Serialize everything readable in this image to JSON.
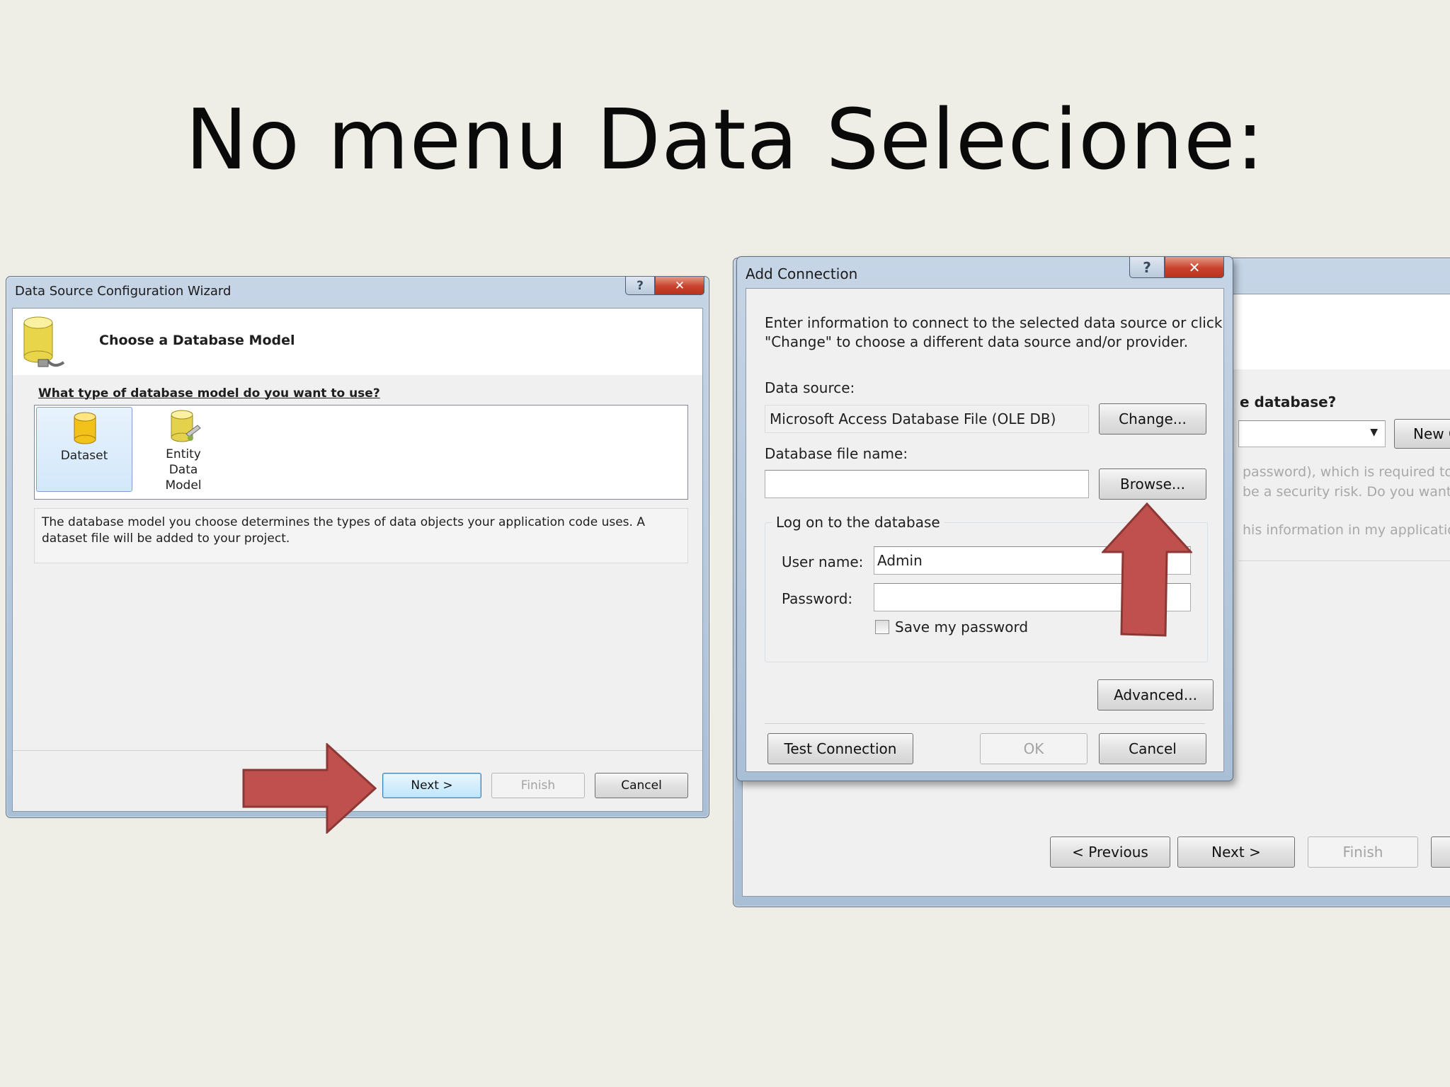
{
  "slide": {
    "title": "No menu Data Selecione:"
  },
  "wizard": {
    "title": "Data Source Configuration Wizard",
    "help_glyph": "?",
    "close_glyph": "✕",
    "heading": "Choose a Database Model",
    "question": "What type of database model do you want to use?",
    "models": [
      {
        "label": "Dataset",
        "selected": true
      },
      {
        "label": "Entity Data Model",
        "selected": false
      }
    ],
    "description": "The database model you choose determines the types of data objects your application code uses. A dataset file will be added to your project.",
    "buttons": {
      "next": "Next >",
      "finish": "Finish",
      "cancel": "Cancel"
    }
  },
  "background_wizard": {
    "question_fragment": "e database?",
    "new_connection_fragment": "New C",
    "help_line1": "password), which is required to",
    "help_line2": "be a security risk. Do you want to",
    "help_line3": "his information in my applicatio",
    "buttons": {
      "previous": "< Previous",
      "next": "Next >",
      "finish": "Finish"
    }
  },
  "add_connection": {
    "title": "Add Connection",
    "help_glyph": "?",
    "close_glyph": "✕",
    "instructions_line1": "Enter information to connect to the selected data source or click",
    "instructions_line2": "\"Change\" to choose a different data source and/or provider.",
    "data_source_label": "Data source:",
    "data_source_value": "Microsoft Access Database File (OLE DB)",
    "change_button": "Change...",
    "db_file_label": "Database file name:",
    "db_file_value": "",
    "browse_button": "Browse...",
    "logon_group": "Log on to the database",
    "username_label": "User name:",
    "username_value": "Admin",
    "password_label": "Password:",
    "password_value": "",
    "save_password_label": "Save my password",
    "save_password_checked": false,
    "advanced_button": "Advanced...",
    "test_button": "Test Connection",
    "ok_button": "OK",
    "cancel_button": "Cancel"
  },
  "colors": {
    "arrow": "#c0504d",
    "arrow_border": "#8c3836",
    "slide_bg": "#eeede6"
  }
}
